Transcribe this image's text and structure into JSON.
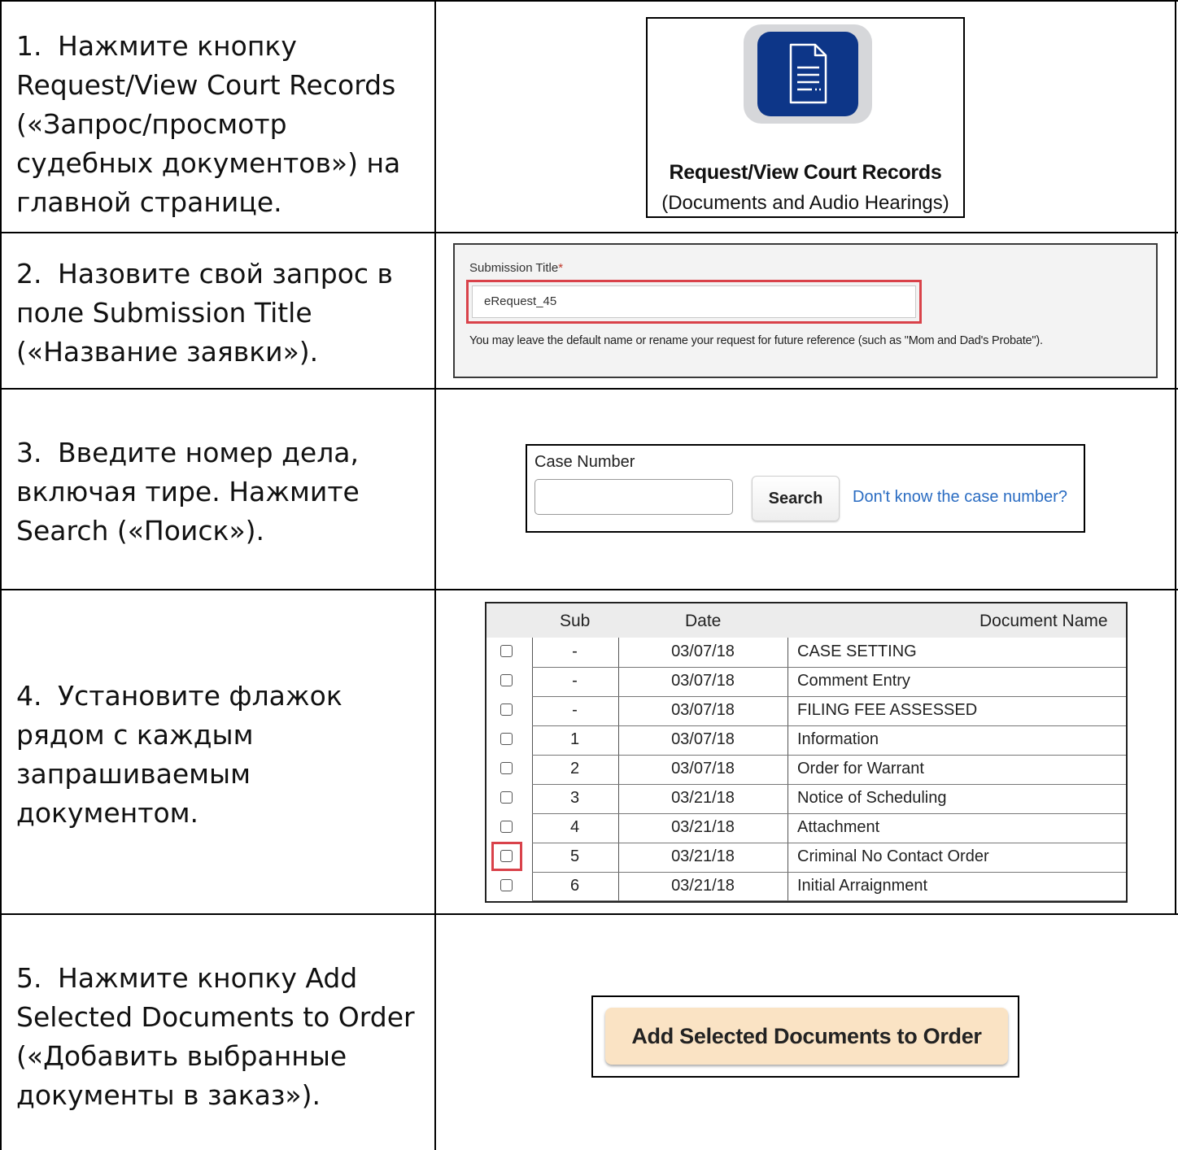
{
  "steps": [
    {
      "num": "1.",
      "text": "Нажмите кнопку Request/View Court Records («Запрос/просмотр судебных документов») на главной странице."
    },
    {
      "num": "2.",
      "text": "Назовите свой запрос в поле Submission Title («Название заявки»)."
    },
    {
      "num": "3.",
      "text": "Введите номер дела, включая тире. Нажмите Search («Поиск»)."
    },
    {
      "num": "4.",
      "text": "Установите флажок рядом с каждым запрашиваемым документом."
    },
    {
      "num": "5.",
      "text": "Нажмите кнопку Add Selected Documents to Order («Добавить выбранные документы в заказ»)."
    }
  ],
  "tile": {
    "icon": "document-icon",
    "title": "Request/View Court Records",
    "subtitle": "(Documents and Audio Hearings)",
    "icon_bg_color": "#0d3688"
  },
  "submission": {
    "label": "Submission Title",
    "required_mark": "*",
    "value": "eRequest_45",
    "help": "You may leave the default name or rename your request for future reference (such as \"Mom and Dad's Probate\")."
  },
  "case_search": {
    "label": "Case Number",
    "value": "",
    "search_label": "Search",
    "link_text": "Don't know the case number?"
  },
  "documents": {
    "headers": {
      "sub": "Sub",
      "date": "Date",
      "name": "Document Name"
    },
    "rows": [
      {
        "sub": "-",
        "date": "03/07/18",
        "name": "CASE SETTING",
        "checked": false
      },
      {
        "sub": "-",
        "date": "03/07/18",
        "name": "Comment Entry",
        "checked": false
      },
      {
        "sub": "-",
        "date": "03/07/18",
        "name": "FILING FEE ASSESSED",
        "checked": false
      },
      {
        "sub": "1",
        "date": "03/07/18",
        "name": "Information",
        "checked": false
      },
      {
        "sub": "2",
        "date": "03/07/18",
        "name": "Order for Warrant",
        "checked": false
      },
      {
        "sub": "3",
        "date": "03/21/18",
        "name": "Notice of Scheduling",
        "checked": false
      },
      {
        "sub": "4",
        "date": "03/21/18",
        "name": "Attachment",
        "checked": false
      },
      {
        "sub": "5",
        "date": "03/21/18",
        "name": "Criminal No Contact Order",
        "checked": false
      },
      {
        "sub": "6",
        "date": "03/21/18",
        "name": "Initial Arraignment",
        "checked": false
      }
    ]
  },
  "add_button": {
    "label": "Add Selected Documents to Order",
    "color": "#fae3c4"
  },
  "highlight_color": "#d9424a"
}
